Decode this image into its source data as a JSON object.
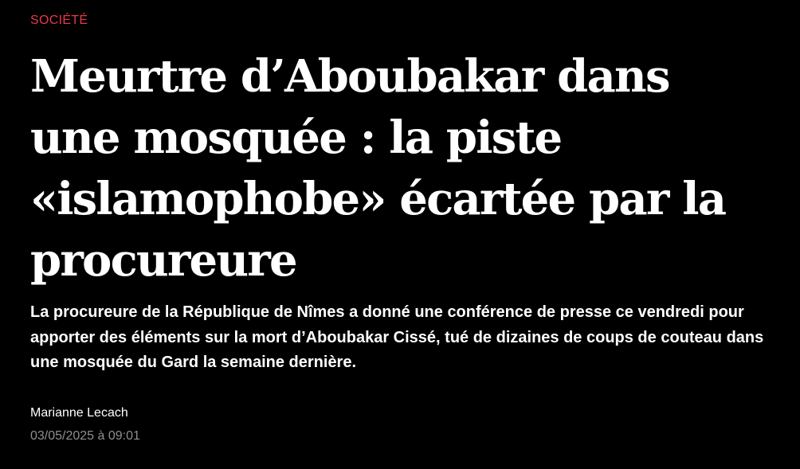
{
  "article": {
    "section": "SOCIÉTÉ",
    "headline": "Meurtre d’Aboubakar dans une mosquée : la piste «islamophobe» écartée par la procureure",
    "standfirst": "La procureure de la République de Nîmes a donné une conférence de presse ce vendredi pour apporter des éléments sur la mort d’Aboubakar Cissé, tué de dizaines de coups de couteau dans une mosquée du Gard la semaine dernière.",
    "author": "Marianne Lecach",
    "date": "03/05/2025 à 09:01"
  },
  "colors": {
    "background": "#000000",
    "section_accent": "#e8394a",
    "text_primary": "#ffffff",
    "text_muted": "#8f8f8f"
  }
}
